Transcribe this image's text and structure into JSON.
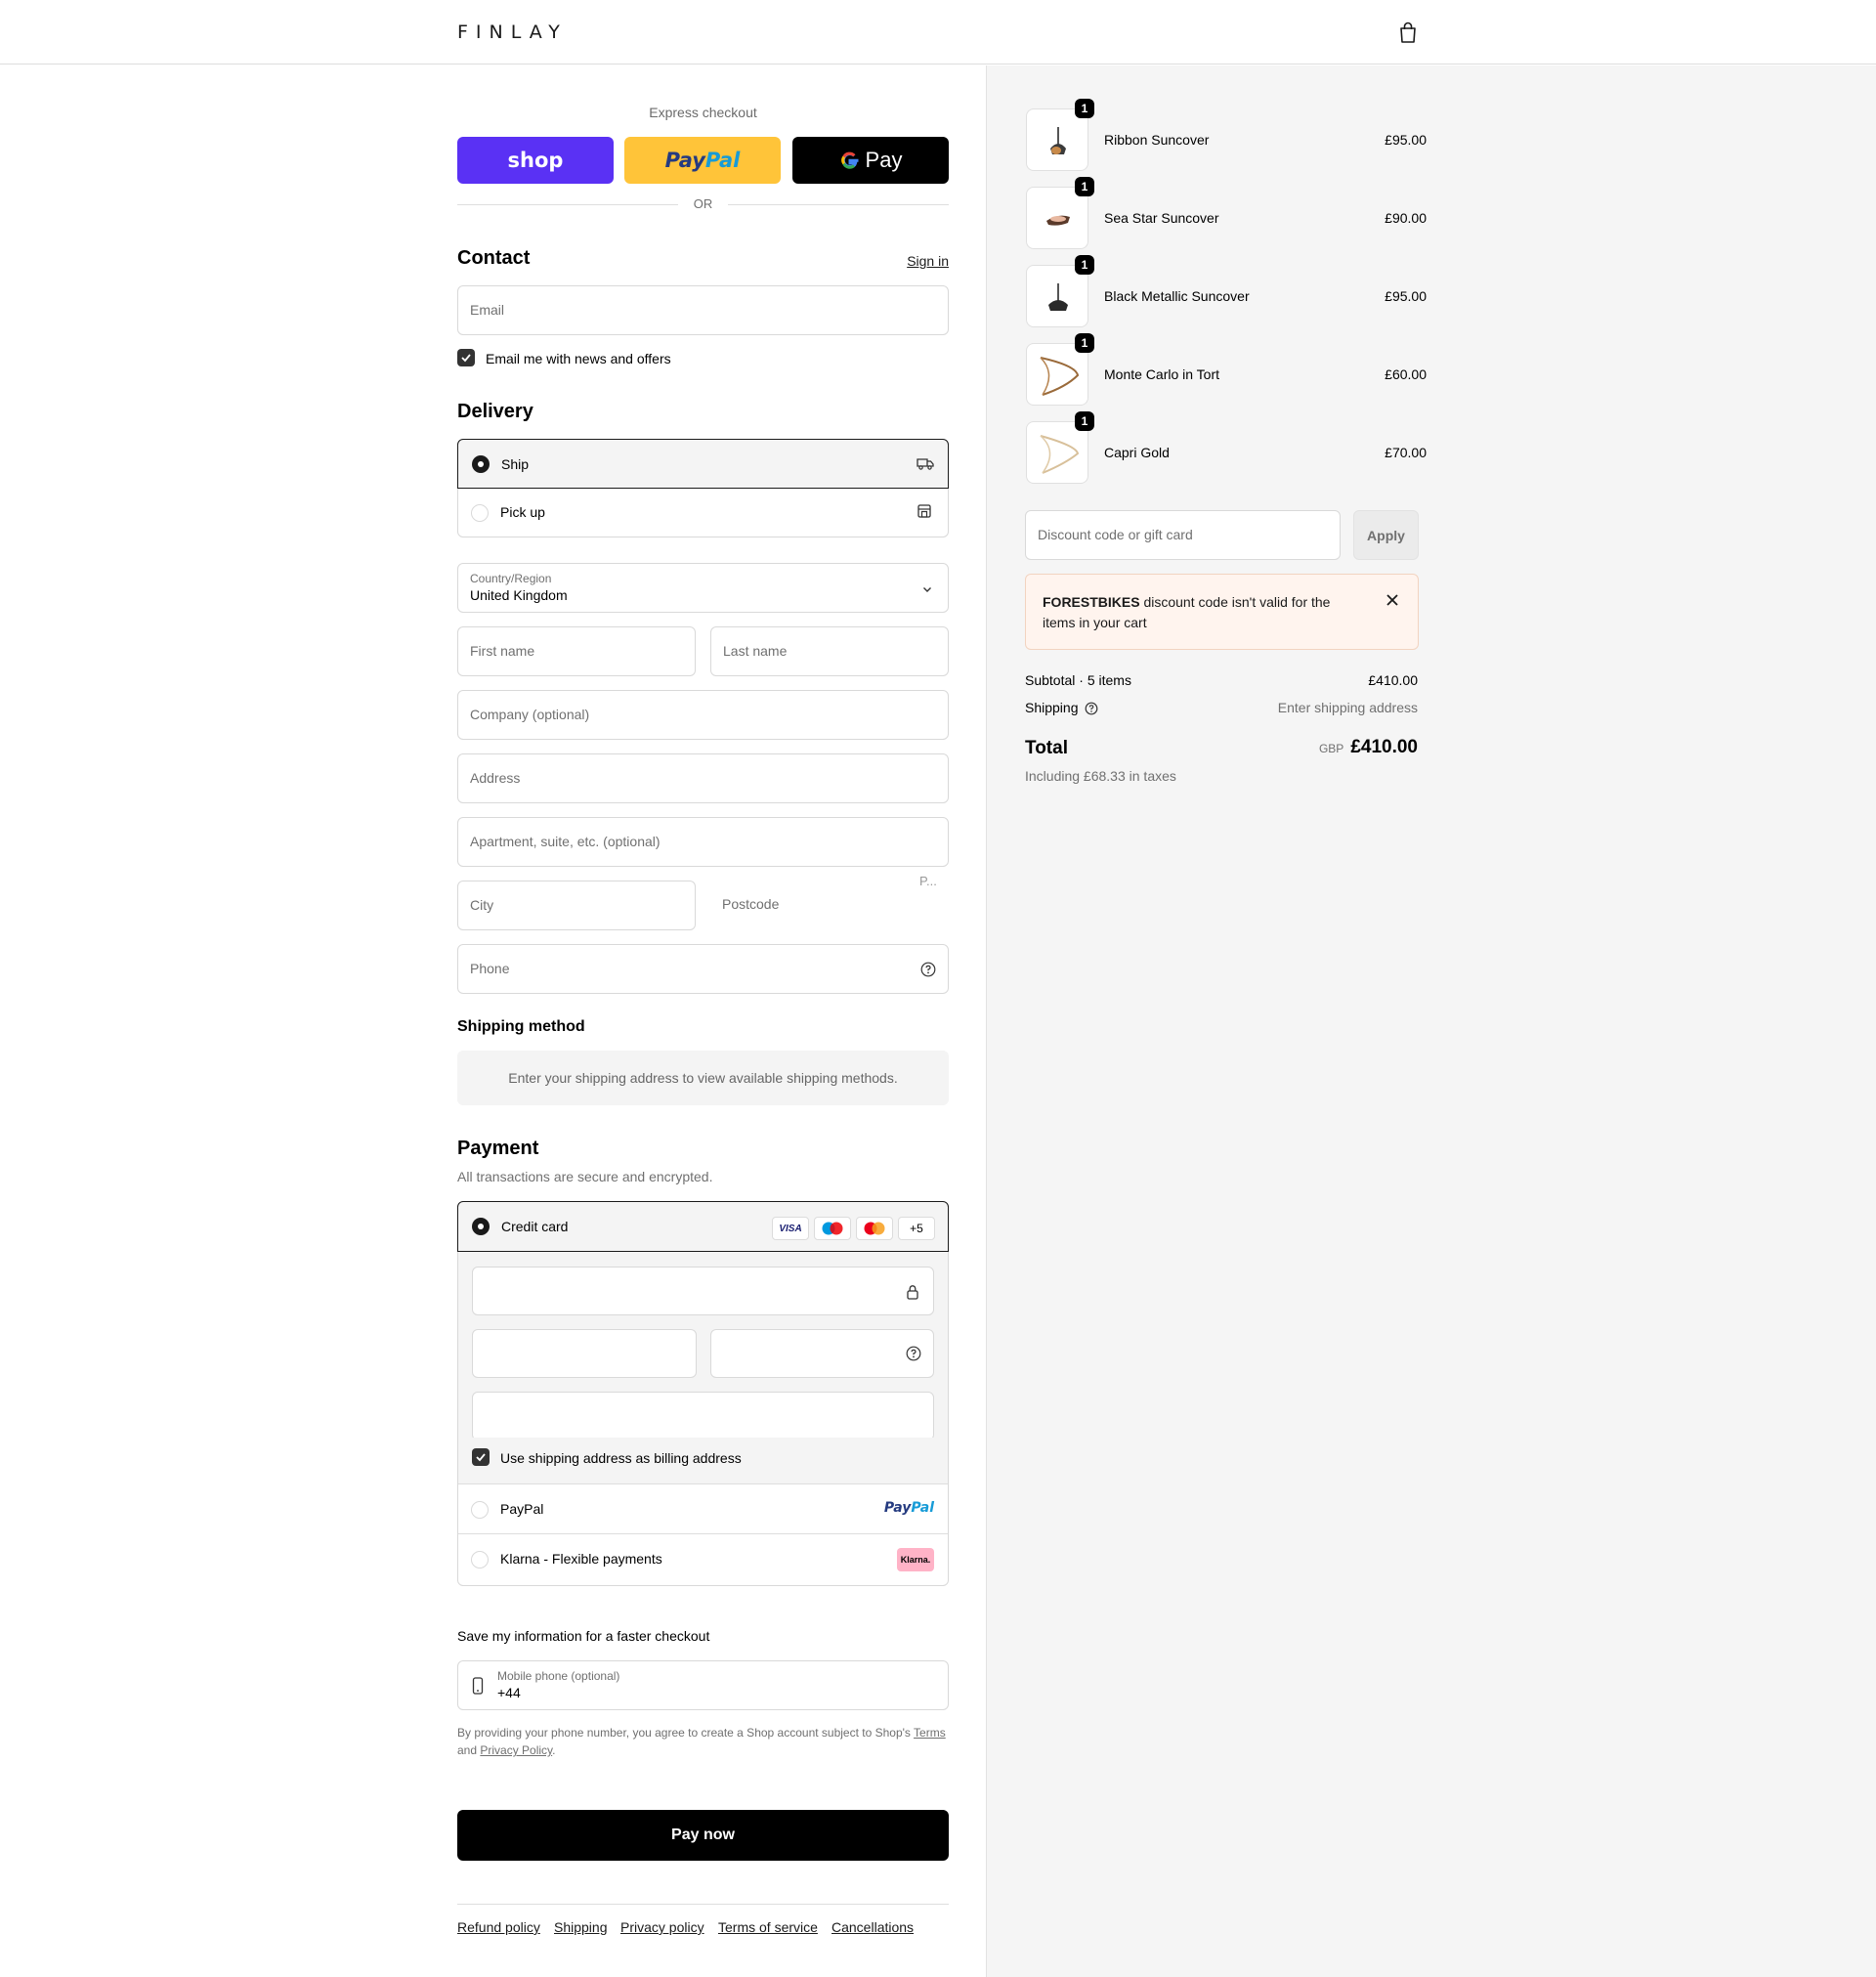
{
  "header": {
    "brand": "FINLAY",
    "bag_icon": "shopping-bag-icon"
  },
  "express": {
    "title": "Express checkout",
    "shop_label": "shop",
    "paypal_label_1": "Pay",
    "paypal_label_2": "Pal",
    "gpay_label": "Pay",
    "or_label": "OR",
    "colors": {
      "shop": "#5a31f4",
      "paypal": "#ffc439",
      "gpay": "#000000"
    }
  },
  "contact": {
    "title": "Contact",
    "sign_in": "Sign in",
    "email_placeholder": "Email",
    "newsletter_label": "Email me with news and offers"
  },
  "delivery": {
    "title": "Delivery",
    "options": [
      {
        "label": "Ship",
        "icon": "truck-icon",
        "selected": true
      },
      {
        "label": "Pick up",
        "icon": "store-icon",
        "selected": false
      }
    ],
    "country_label": "Country/Region",
    "country_value": "United Kingdom",
    "first_name": "First name",
    "last_name": "Last name",
    "company": "Company (optional)",
    "address": "Address",
    "apartment": "Apartment, suite, etc. (optional)",
    "city": "City",
    "postcode": "Postcode",
    "postcode_small": "P...",
    "phone": "Phone"
  },
  "shipping_method": {
    "title": "Shipping method",
    "notice": "Enter your shipping address to view available shipping methods."
  },
  "payment": {
    "title": "Payment",
    "subtitle": "All transactions are secure and encrypted.",
    "credit_card_label": "Credit card",
    "card_brands": [
      "VISA",
      "Maestro",
      "Mastercard"
    ],
    "more_brands": "+5",
    "billing_label": "Use shipping address as billing address",
    "paypal_option": "PayPal",
    "paypal_logo_1": "Pay",
    "paypal_logo_2": "Pal",
    "klarna_option": "Klarna - Flexible payments",
    "klarna_logo": "Klarna."
  },
  "save_info": {
    "title": "Save my information for a faster checkout",
    "phone_label": "Mobile phone (optional)",
    "phone_value": "+44",
    "legal_1": "By providing your phone number, you agree to create a Shop account subject to Shop's ",
    "terms": "Terms",
    "legal_2": "and ",
    "privacy": "Privacy Policy",
    "legal_3": "."
  },
  "pay_button": "Pay now",
  "footer_links": [
    "Refund policy",
    "Shipping",
    "Privacy policy",
    "Terms of service",
    "Cancellations"
  ],
  "cart": {
    "items": [
      {
        "name": "Ribbon Suncover",
        "qty": "1",
        "price": "£95.00"
      },
      {
        "name": "Sea Star Suncover",
        "qty": "1",
        "price": "£90.00"
      },
      {
        "name": "Black Metallic Suncover",
        "qty": "1",
        "price": "£95.00"
      },
      {
        "name": "Monte Carlo in Tort",
        "qty": "1",
        "price": "£60.00"
      },
      {
        "name": "Capri Gold",
        "qty": "1",
        "price": "£70.00"
      }
    ],
    "discount_placeholder": "Discount code or gift card",
    "apply_label": "Apply",
    "alert_code": "FORESTBIKES",
    "alert_text_1": " discount code isn't valid for the",
    "alert_text_2": "items in your cart",
    "subtotal_label": "Subtotal · 5 items",
    "subtotal_value": "£410.00",
    "shipping_label": "Shipping",
    "shipping_value": "Enter shipping address",
    "total_label": "Total",
    "currency": "GBP",
    "total_value": "£410.00",
    "taxes": "Including £68.33 in taxes"
  }
}
